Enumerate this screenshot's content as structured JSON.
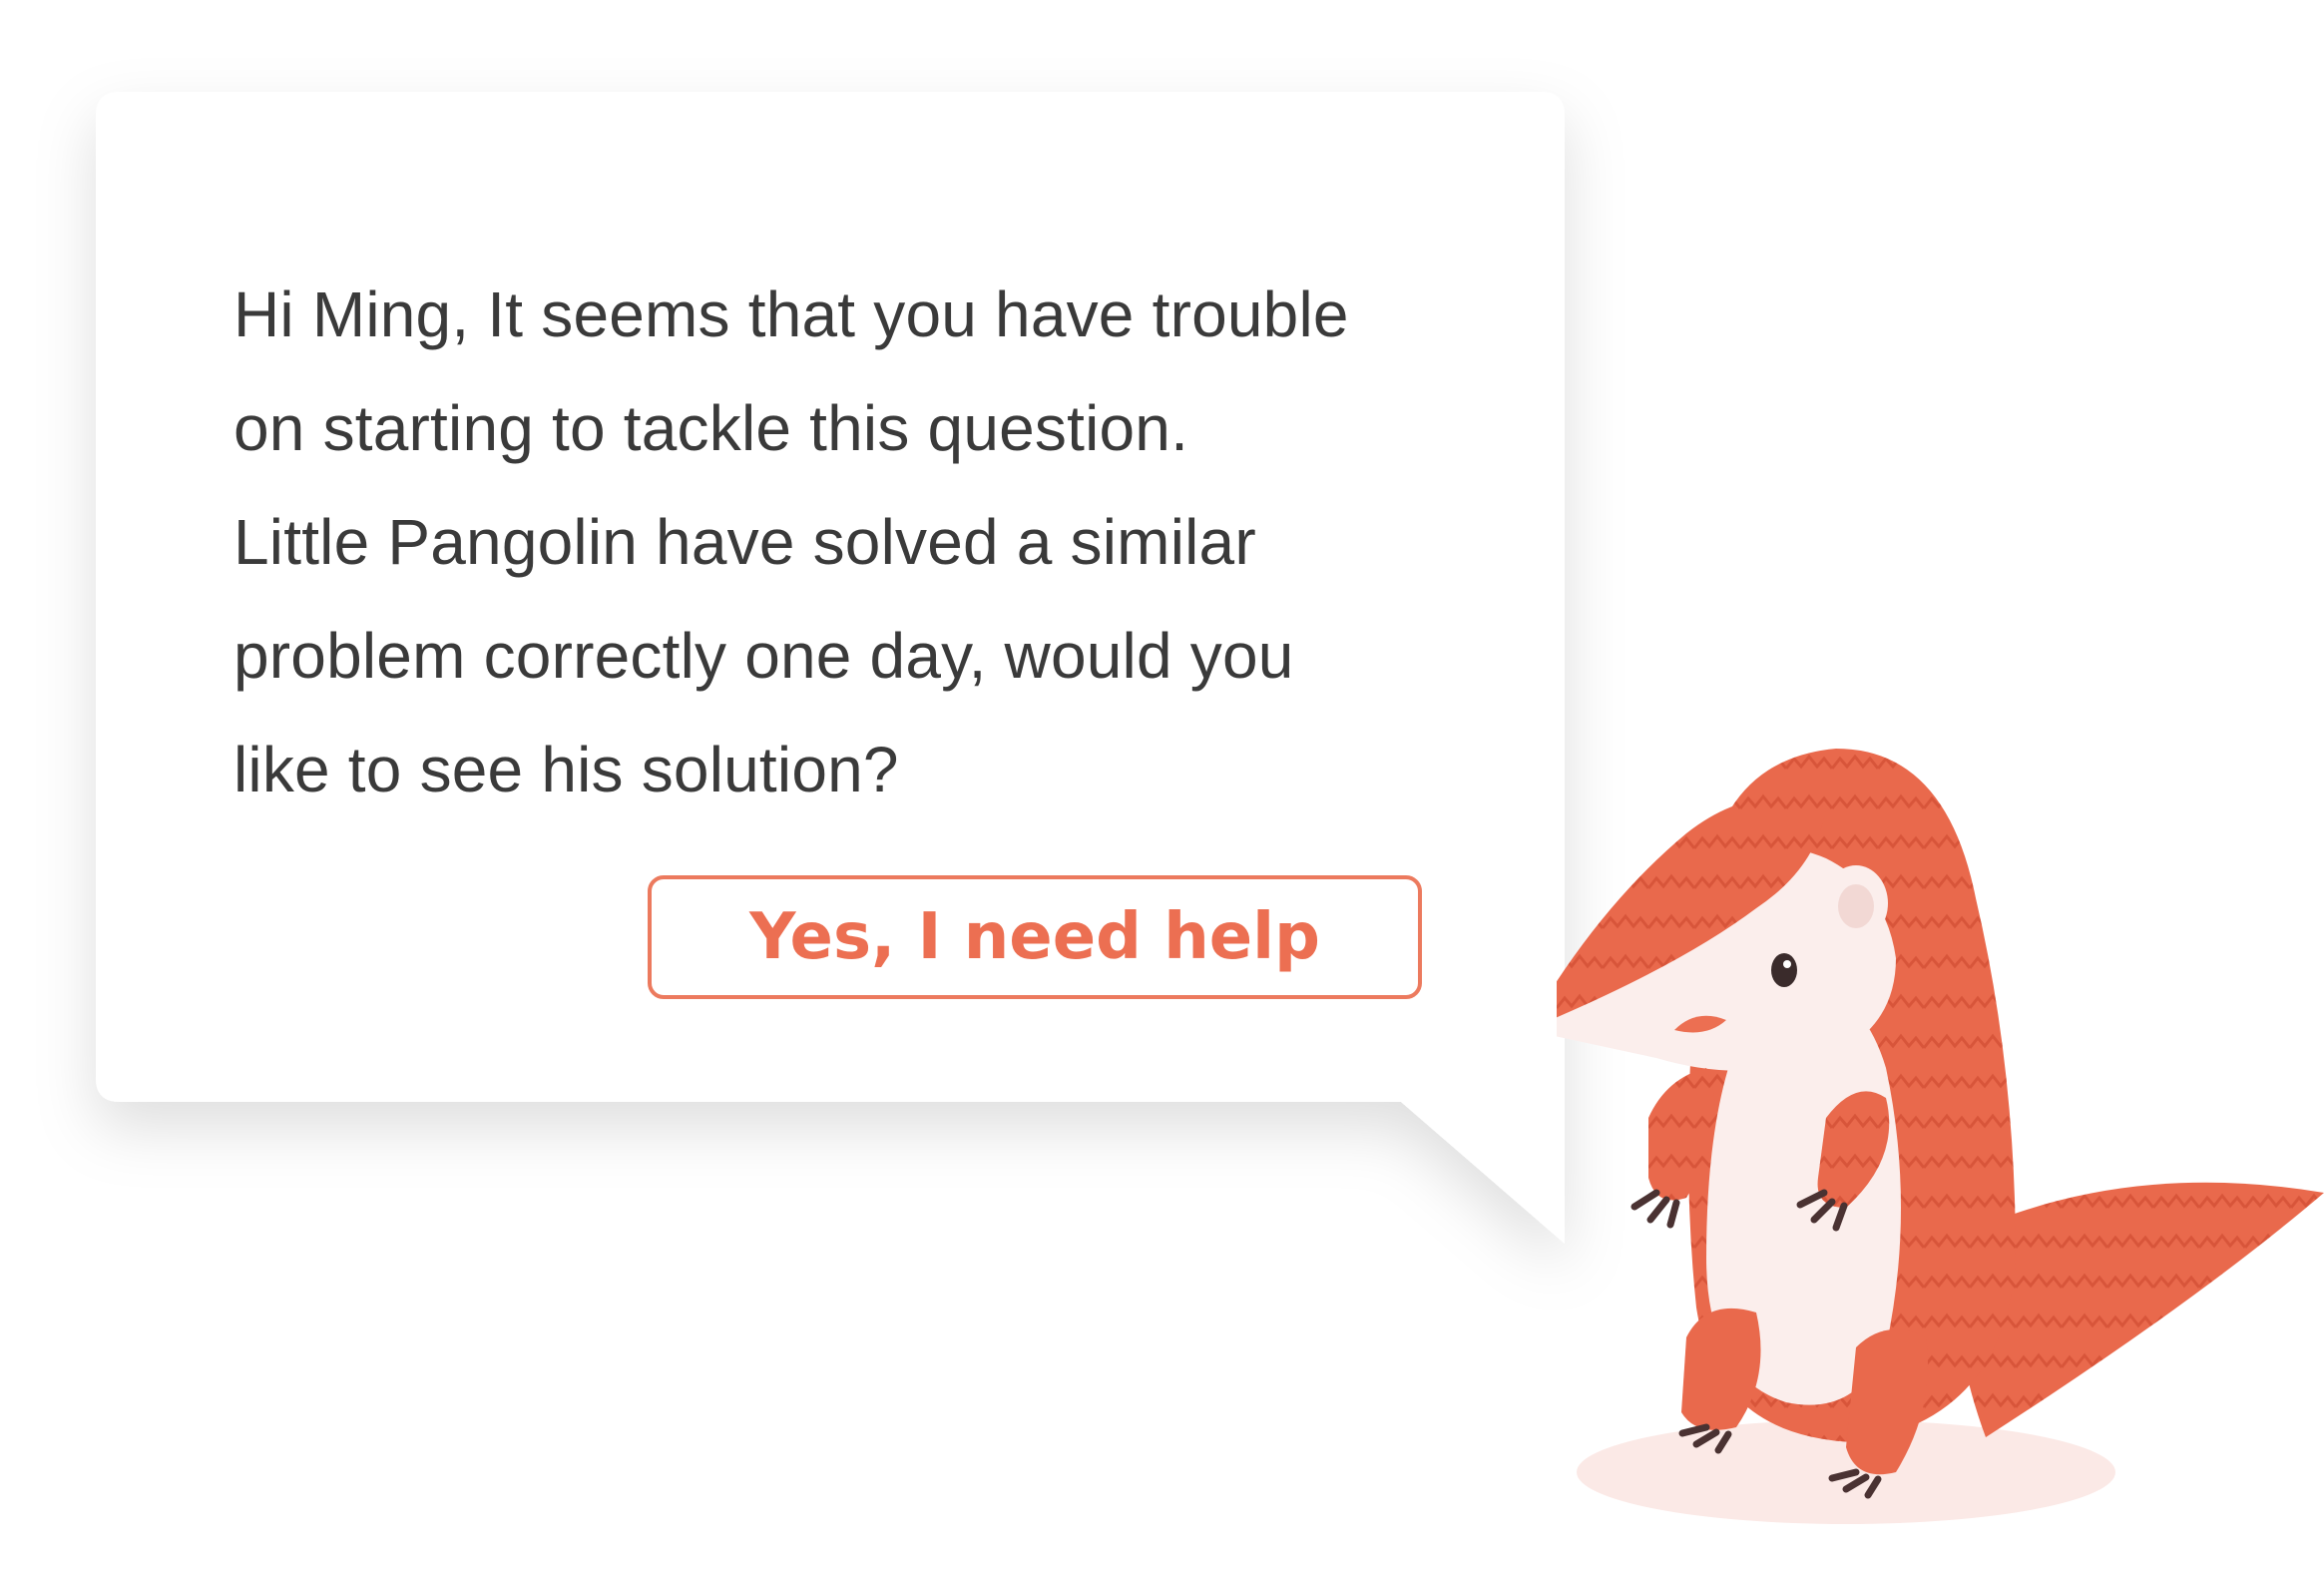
{
  "dialog": {
    "message_lines": [
      "Hi Ming, It seems that you have trouble",
      "on starting to tackle this question.",
      "Little Pangolin have solved a similar",
      "problem correctly one day, would you",
      "like to see his solution?"
    ],
    "help_button_label": "Yes, I need help"
  },
  "colors": {
    "accent": "#ec6f52",
    "text": "#3a3a3a",
    "bubble_background": "#ffffff",
    "mascot_body": "#e9694c",
    "mascot_belly": "#fbeeec"
  },
  "icons": {
    "mascot": "pangolin-mascot-icon"
  }
}
